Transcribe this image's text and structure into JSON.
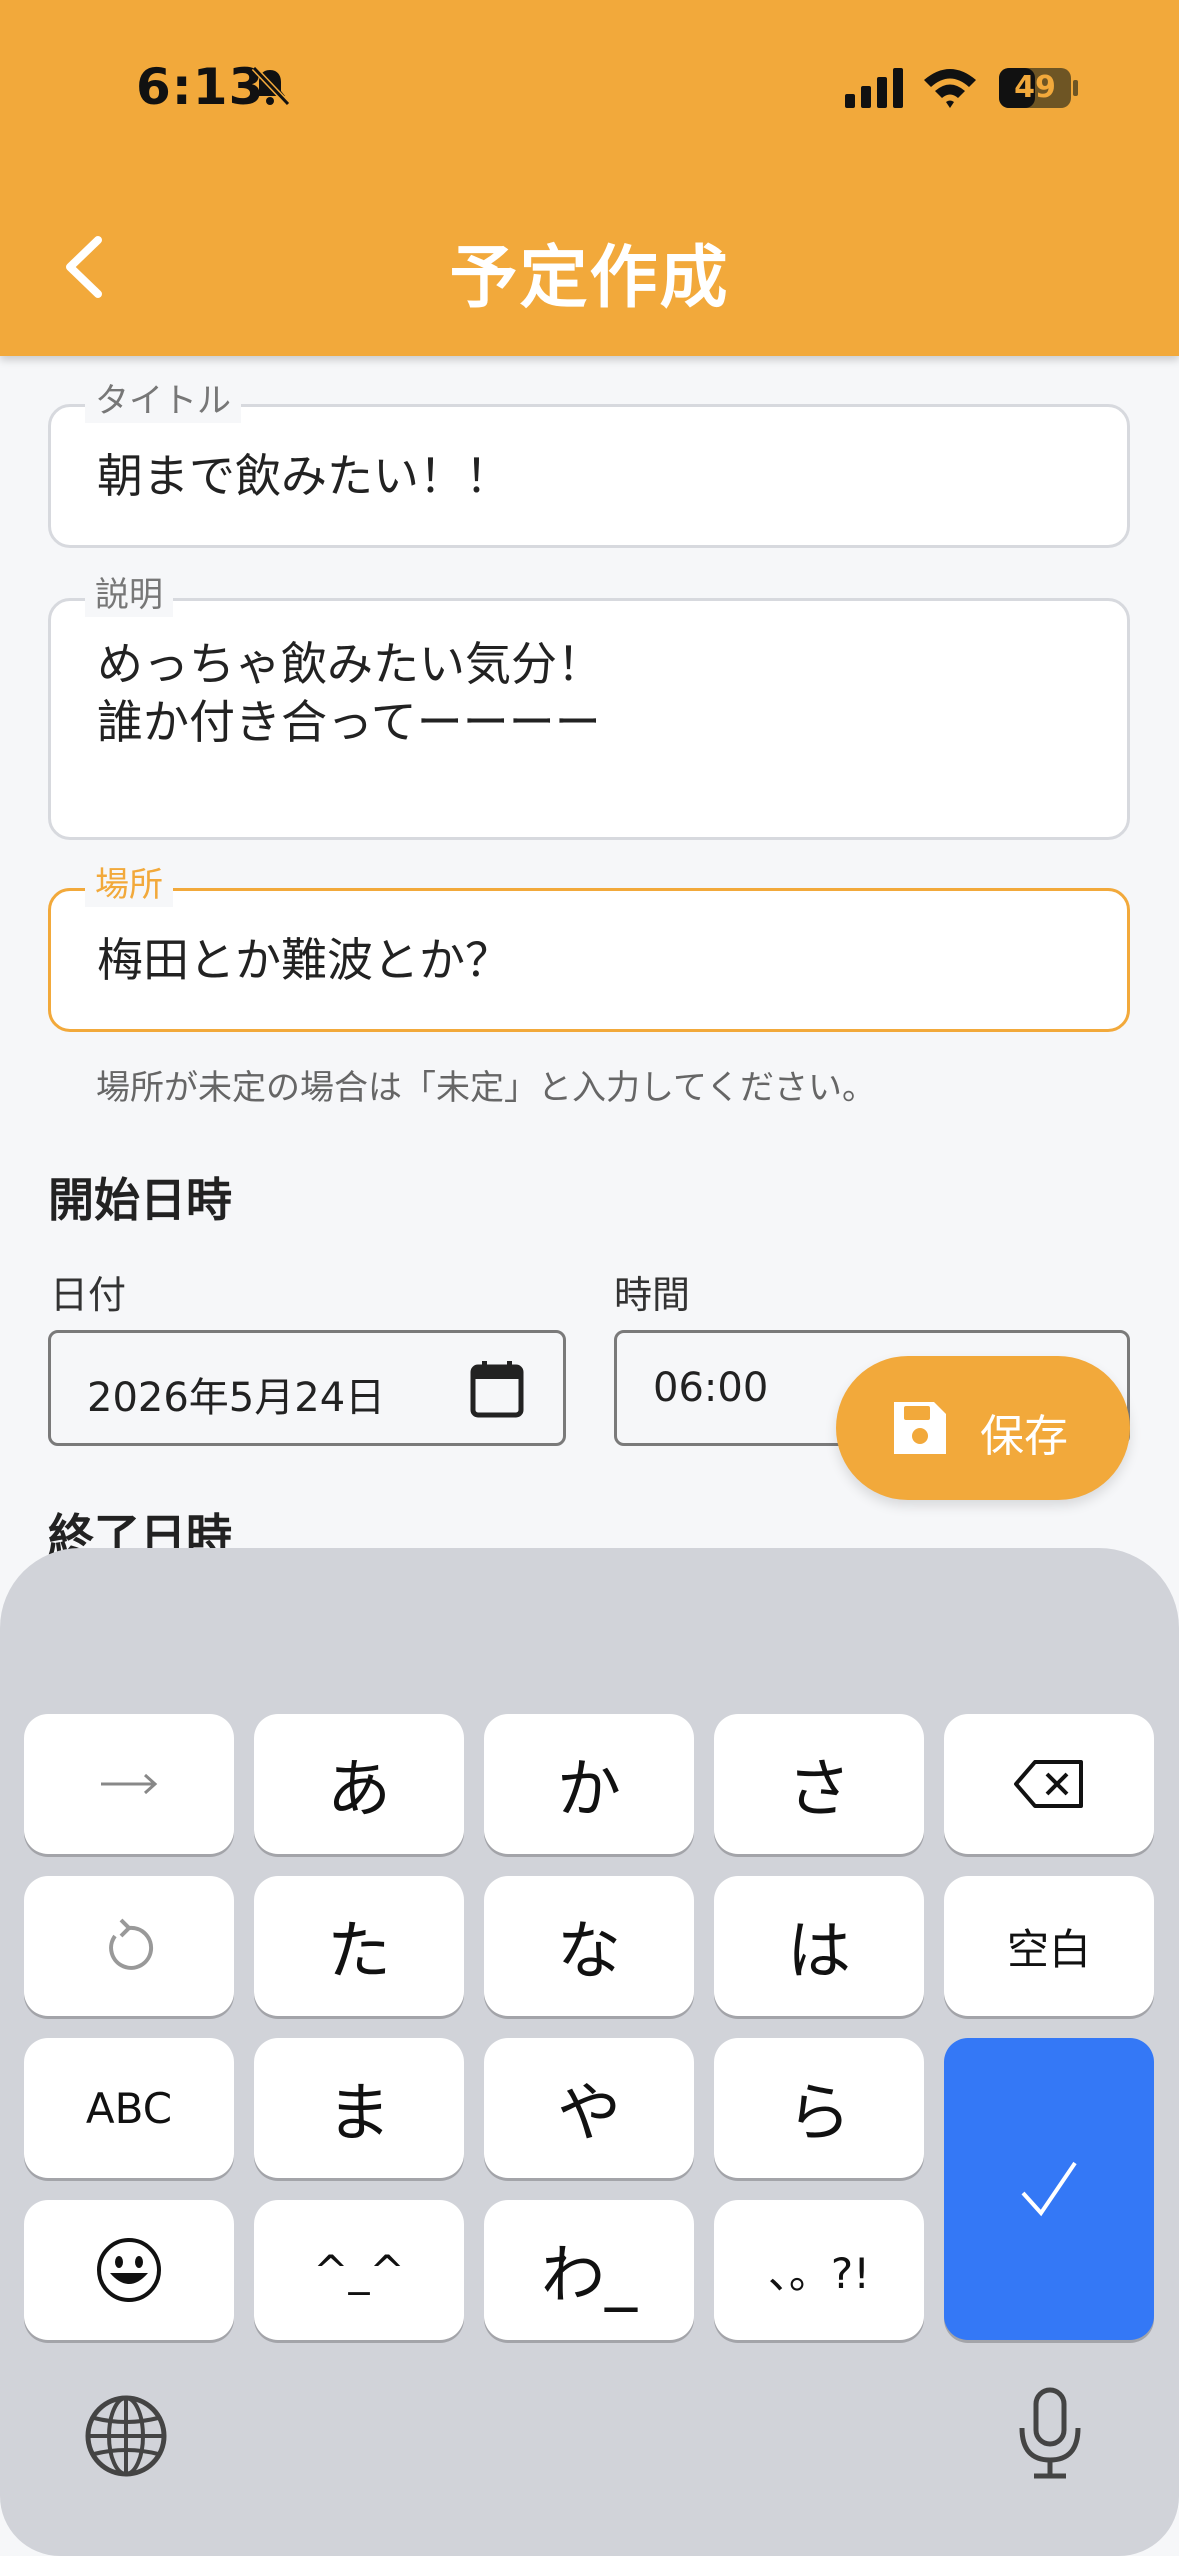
{
  "status_bar": {
    "time": "6:13",
    "battery": "49"
  },
  "header": {
    "title": "予定作成"
  },
  "form": {
    "title_field": {
      "label": "タイトル",
      "value": "朝まで飲みたい！！"
    },
    "description_field": {
      "label": "説明",
      "value": "めっちゃ飲みたい気分！\n誰か付き合ってーーーー"
    },
    "location_field": {
      "label": "場所",
      "value": "梅田とか難波とか？",
      "helper": "場所が未定の場合は「未定」と入力してください。"
    },
    "start": {
      "section_title": "開始日時",
      "date_label": "日付",
      "date_value": "2026年5月24日",
      "time_label": "時間",
      "time_value": "06:00"
    },
    "end": {
      "section_title": "終了日時"
    }
  },
  "save_button": {
    "label": "保存"
  },
  "keyboard": {
    "row1": [
      "→",
      "あ",
      "か",
      "さ"
    ],
    "row2": [
      "↺",
      "た",
      "な",
      "は",
      "空白"
    ],
    "row3": [
      "ABC",
      "ま",
      "や",
      "ら"
    ],
    "row4": [
      "☺",
      "^_^",
      "わ_",
      "、。?!"
    ],
    "icons": [
      "right-arrow-icon",
      "backspace-icon",
      "undo-icon",
      "emoji-icon",
      "checkmark-icon",
      "globe-icon",
      "microphone-icon"
    ]
  },
  "colors": {
    "accent": "#f2a93b",
    "keyboard_bg": "#d1d3d9",
    "enter_key": "#3478f6"
  }
}
